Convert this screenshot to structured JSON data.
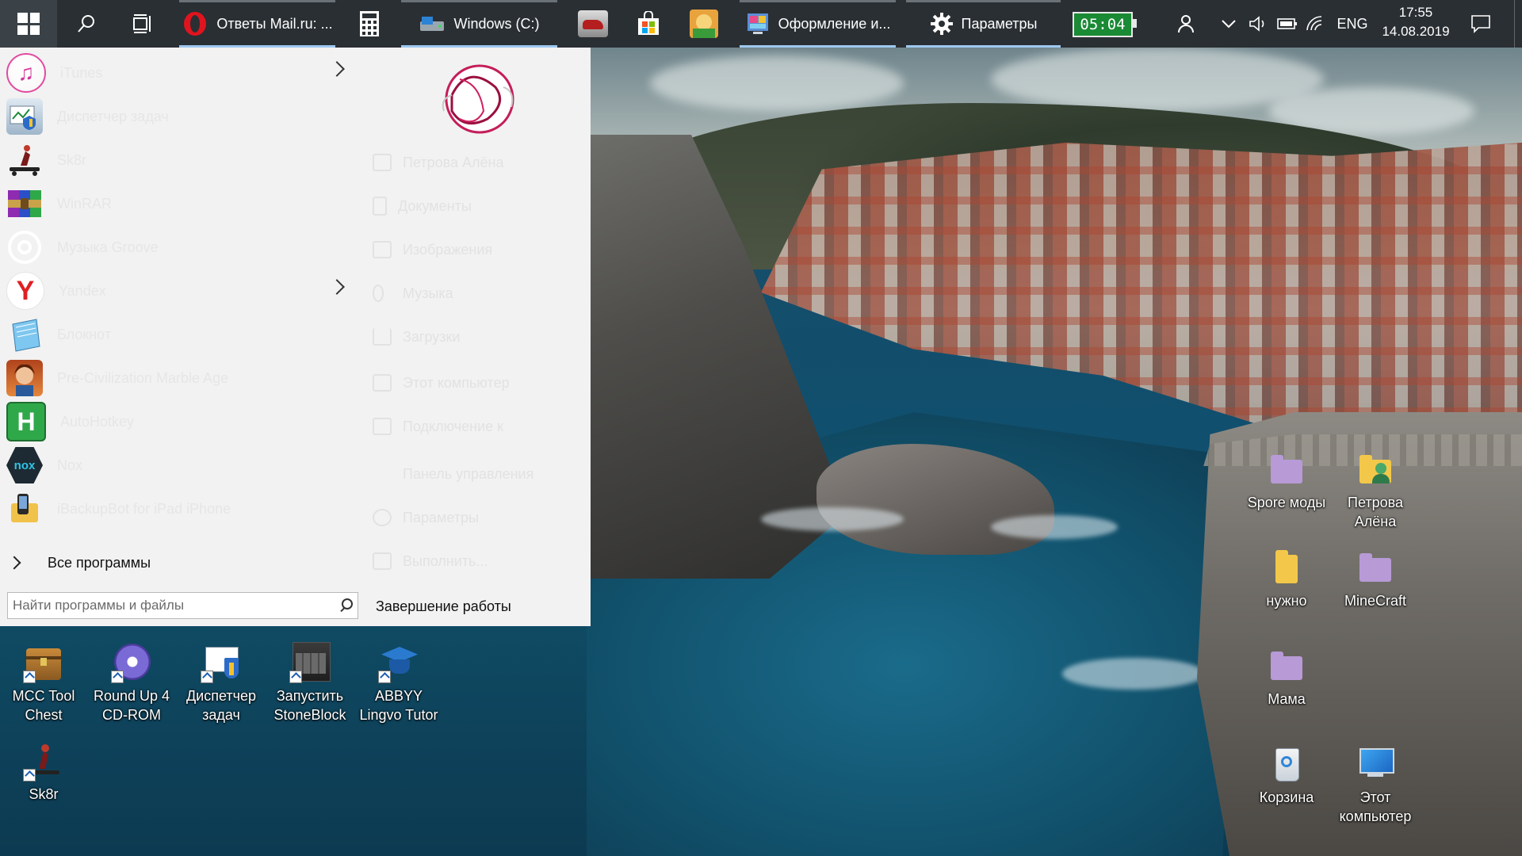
{
  "taskbar": {
    "windows": [
      {
        "id": "opera",
        "label": "Ответы Mail.ru: ...",
        "icon": "opera-icon",
        "active": true
      },
      {
        "id": "calc",
        "label": "",
        "icon": "calculator-icon",
        "active": false
      },
      {
        "id": "explorer",
        "label": "Windows (C:)",
        "icon": "drive-icon",
        "active": true
      },
      {
        "id": "game1",
        "label": "",
        "icon": "game-icon",
        "active": false
      },
      {
        "id": "store",
        "label": "",
        "icon": "store-icon",
        "active": false
      },
      {
        "id": "game2",
        "label": "",
        "icon": "cartoon-game-icon",
        "active": false
      },
      {
        "id": "personalize",
        "label": "Оформление и...",
        "icon": "personalization-icon",
        "active": true
      },
      {
        "id": "settings",
        "label": "Параметры",
        "icon": "gear-icon",
        "active": true
      }
    ],
    "battery_timer": "05:04",
    "tray": {
      "language": "ENG",
      "time": "17:55",
      "date": "14.08.2019"
    }
  },
  "start_menu": {
    "apps": [
      {
        "label": "iTunes",
        "icon": "itunes-icon",
        "submenu": true
      },
      {
        "label": "Диспетчер задач",
        "icon": "task-manager-icon",
        "submenu": false
      },
      {
        "label": "Sk8r",
        "icon": "skater-icon",
        "submenu": false
      },
      {
        "label": "WinRAR",
        "icon": "winrar-icon",
        "submenu": false
      },
      {
        "label": "Музыка Groove",
        "icon": "groove-music-icon",
        "submenu": false
      },
      {
        "label": "Yandex",
        "icon": "yandex-icon",
        "submenu": true
      },
      {
        "label": "Блокнот",
        "icon": "notepad-icon",
        "submenu": false
      },
      {
        "label": "Pre-Civilization Marble Age",
        "icon": "game-portrait-icon",
        "submenu": false
      },
      {
        "label": "AutoHotkey",
        "icon": "autohotkey-icon",
        "submenu": false
      },
      {
        "label": "Nox",
        "icon": "nox-icon",
        "submenu": false
      },
      {
        "label": "iBackupBot for iPad iPhone",
        "icon": "ibackupbot-icon",
        "submenu": false
      }
    ],
    "places": [
      {
        "label": "Петрова Алёна",
        "icon": "user-folder-icon"
      },
      {
        "label": "Документы",
        "icon": "documents-icon"
      },
      {
        "label": "Изображения",
        "icon": "pictures-icon"
      },
      {
        "label": "Музыка",
        "icon": "music-icon"
      },
      {
        "label": "Загрузки",
        "icon": "downloads-icon"
      },
      {
        "label": "Этот компьютер",
        "icon": "computer-icon"
      },
      {
        "label": "Подключение к",
        "icon": "connect-icon"
      },
      {
        "label": "Панель управления",
        "icon": "control-panel-icon"
      },
      {
        "label": "Параметры",
        "icon": "settings-icon"
      },
      {
        "label": "Выполнить...",
        "icon": "run-icon"
      }
    ],
    "all_programs": "Все программы",
    "search_placeholder": "Найти программы и файлы",
    "shutdown": "Завершение работы"
  },
  "desktop_icons": [
    {
      "label": "MCC Tool Chest",
      "icon": "chest-icon",
      "shortcut": true
    },
    {
      "label": "Round Up 4 CD-ROM",
      "icon": "cd-rom-app-icon",
      "shortcut": true
    },
    {
      "label": "Диспетчер задач",
      "icon": "task-manager-icon",
      "shortcut": true
    },
    {
      "label": "Запустить StoneBlock",
      "icon": "stoneblock-icon",
      "shortcut": true
    },
    {
      "label": "ABBYY Lingvo Tutor",
      "icon": "lingvo-icon",
      "shortcut": true
    },
    {
      "label": "Sk8r",
      "icon": "skater-icon",
      "shortcut": true
    },
    {
      "label": "Spore моды",
      "icon": "folder-icon",
      "shortcut": false
    },
    {
      "label": "Петрова Алёна",
      "icon": "user-folder-icon",
      "shortcut": false
    },
    {
      "label": "нужно",
      "icon": "folder-icon",
      "shortcut": false
    },
    {
      "label": "MineCraft",
      "icon": "folder-icon",
      "shortcut": false
    },
    {
      "label": "Мама",
      "icon": "folder-icon",
      "shortcut": false
    },
    {
      "label": "Корзина",
      "icon": "recycle-bin-icon",
      "shortcut": false
    },
    {
      "label": "Этот компьютер",
      "icon": "computer-icon",
      "shortcut": false
    }
  ],
  "colors": {
    "taskbar_bg": "#2a2f33",
    "start_menu_bg": "#f2f2f2",
    "active_indicator": "#9ec8ef",
    "battery_badge": "#1a8a35",
    "purple_folder": "#b79ad6",
    "yellow_folder": "#f3c84a"
  }
}
